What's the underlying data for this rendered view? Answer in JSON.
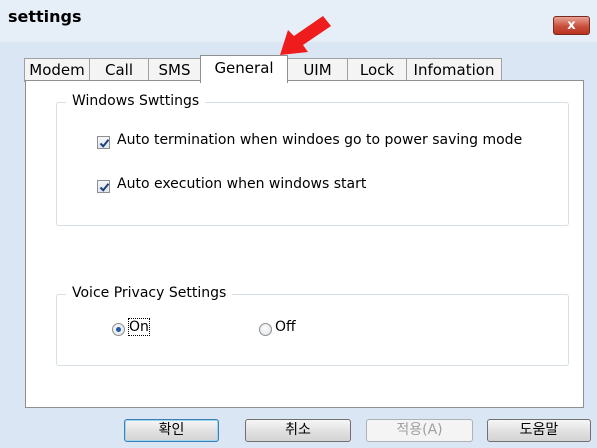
{
  "window": {
    "title": "settings",
    "close_label": "x"
  },
  "tabs": [
    {
      "label": "Modem",
      "active": false
    },
    {
      "label": "Call",
      "active": false
    },
    {
      "label": "SMS",
      "active": false
    },
    {
      "label": "General",
      "active": true
    },
    {
      "label": "UIM",
      "active": false
    },
    {
      "label": "Lock",
      "active": false
    },
    {
      "label": "Infomation",
      "active": false
    }
  ],
  "windows_settings": {
    "legend": "Windows Swttings",
    "options": [
      {
        "label": "Auto termination when windoes go to power saving mode",
        "checked": true
      },
      {
        "label": "Auto execution when windows start",
        "checked": true
      }
    ]
  },
  "voice_privacy": {
    "legend": "Voice Privacy Settings",
    "options": [
      {
        "label": "On",
        "selected": true
      },
      {
        "label": "Off",
        "selected": false
      }
    ]
  },
  "buttons": {
    "ok": "확인",
    "cancel": "취소",
    "apply": "적용(A)",
    "help": "도움말"
  },
  "colors": {
    "annotation_arrow": "#ee1c1c",
    "close_button": "#c9503d",
    "radio_dot": "#1f5aa8"
  }
}
